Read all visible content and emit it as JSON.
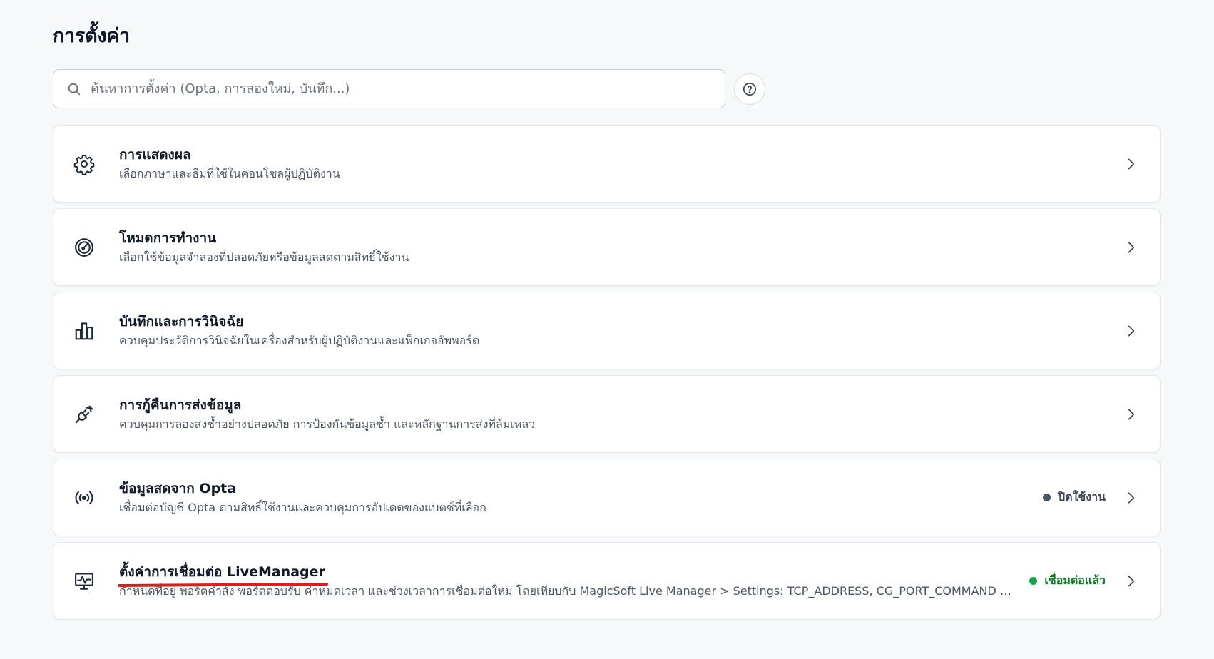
{
  "page": {
    "title": "การตั้งค่า"
  },
  "search": {
    "placeholder": "ค้นหาการตั้งค่า (Opta, การลองใหม่, บันทึก...)"
  },
  "help": {
    "icon": "help-circle-icon"
  },
  "colors": {
    "status_connected": "#16a34a",
    "status_disabled": "#4b5563",
    "annotation_underline": "#e01b1b"
  },
  "cards": [
    {
      "icon": "gear-icon",
      "title": "การแสดงผล",
      "description": "เลือกภาษาและธีมที่ใช้ในคอนโซลผู้ปฏิบัติงาน"
    },
    {
      "icon": "gauge-icon",
      "title": "โหมดการทำงาน",
      "description": "เลือกใช้ข้อมูลจำลองที่ปลอดภัยหรือข้อมูลสดตามสิทธิ์ใช้งาน"
    },
    {
      "icon": "bar-chart-icon",
      "title": "บันทึกและการวินิจฉัย",
      "description": "ควบคุมประวัติการวินิจฉัยในเครื่องสำหรับผู้ปฏิบัติงานและแพ็กเกจอัพพอร์ต"
    },
    {
      "icon": "plug-icon",
      "title": "การกู้คืนการส่งข้อมูล",
      "description": "ควบคุมการลองส่งซ้ำอย่างปลอดภัย การป้องกันข้อมูลซ้ำ และหลักฐานการส่งที่ล้มเหลว"
    },
    {
      "icon": "broadcast-icon",
      "title": "ข้อมูลสดจาก Opta",
      "description": "เชื่อมต่อบัญชี Opta ตามสิทธิ์ใช้งานและควบคุมการอัปเดตของแบตช์ที่เลือก",
      "status": "ปิดใช้งาน"
    },
    {
      "icon": "monitor-activity-icon",
      "title": "ตั้งค่าการเชื่อมต่อ LiveManager",
      "description": "กำหนดที่อยู่ พอร์ตคำสั่ง พอร์ตตอบรับ ค่าหมดเวลา และช่วงเวลาการเชื่อมต่อใหม่ โดยเทียบกับ MagicSoft Live Manager > Settings: TCP_ADDRESS, CG_PORT_COMMAND และ CG_PORT_FEEDBACK",
      "status": "เชื่อมต่อแล้ว"
    }
  ]
}
